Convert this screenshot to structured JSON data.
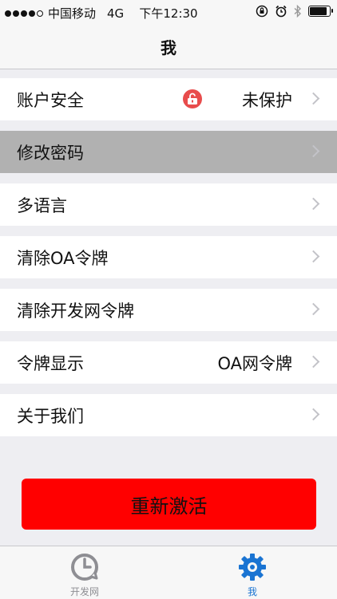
{
  "status_bar": {
    "carrier": "中国移动",
    "network": "4G",
    "time": "下午12:30"
  },
  "nav": {
    "title": "我"
  },
  "rows": [
    {
      "label": "账户安全",
      "value": "未保护"
    },
    {
      "label": "修改密码"
    },
    {
      "label": "多语言"
    },
    {
      "label": "清除OA令牌"
    },
    {
      "label": "清除开发网令牌"
    },
    {
      "label": "令牌显示",
      "value": "OA网令牌"
    },
    {
      "label": "关于我们"
    }
  ],
  "reactivate_button": {
    "label": "重新激活"
  },
  "tabs": [
    {
      "label": "开发网",
      "icon": "clock-refresh-icon"
    },
    {
      "label": "我",
      "icon": "gear-icon"
    }
  ],
  "colors": {
    "accent_blue": "#1a74d2",
    "button_red": "#ff0000",
    "lock_red": "#e84c4c",
    "selected_row": "#b1b1b1"
  }
}
